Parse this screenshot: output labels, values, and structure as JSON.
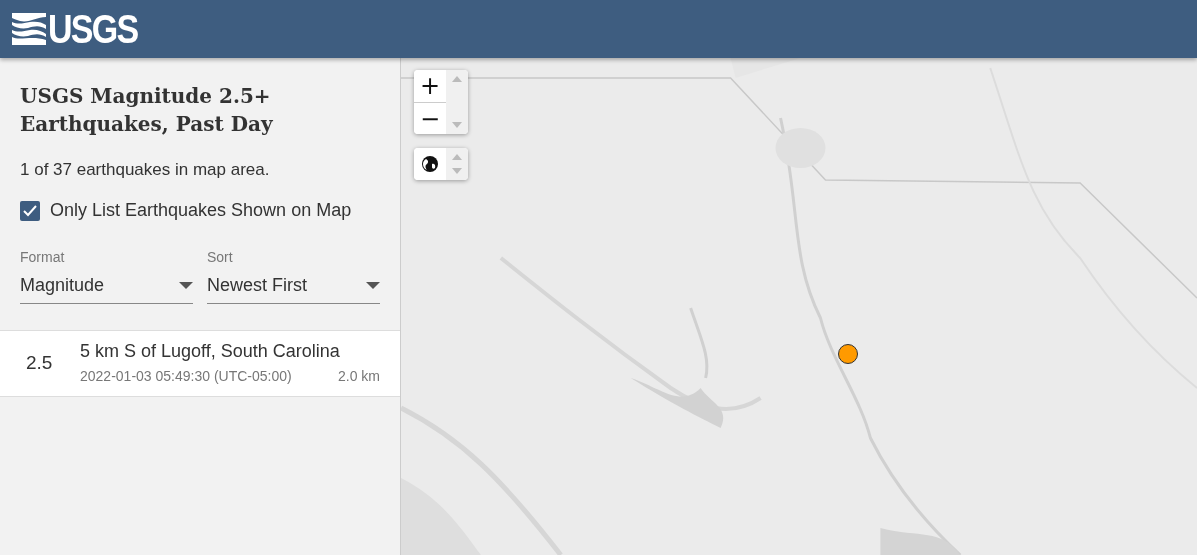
{
  "header": {
    "logo_text": "USGS"
  },
  "sidebar": {
    "title": "USGS Magnitude 2.5+ Earthquakes, Past Day",
    "count_text": "1 of 37 earthquakes in map area.",
    "filter_checkbox": {
      "label": "Only List Earthquakes Shown on Map",
      "checked": true
    },
    "selects": [
      {
        "label": "Format",
        "value": "Magnitude"
      },
      {
        "label": "Sort",
        "value": "Newest First"
      }
    ],
    "earthquakes": [
      {
        "magnitude": "2.5",
        "place": "5 km S of Lugoff, South Carolina",
        "time": "2022-01-03 05:49:30 (UTC-05:00)",
        "depth": "2.0 km"
      }
    ]
  },
  "map": {
    "zoom_in": "+",
    "zoom_out": "−",
    "kind": "picture"
  }
}
